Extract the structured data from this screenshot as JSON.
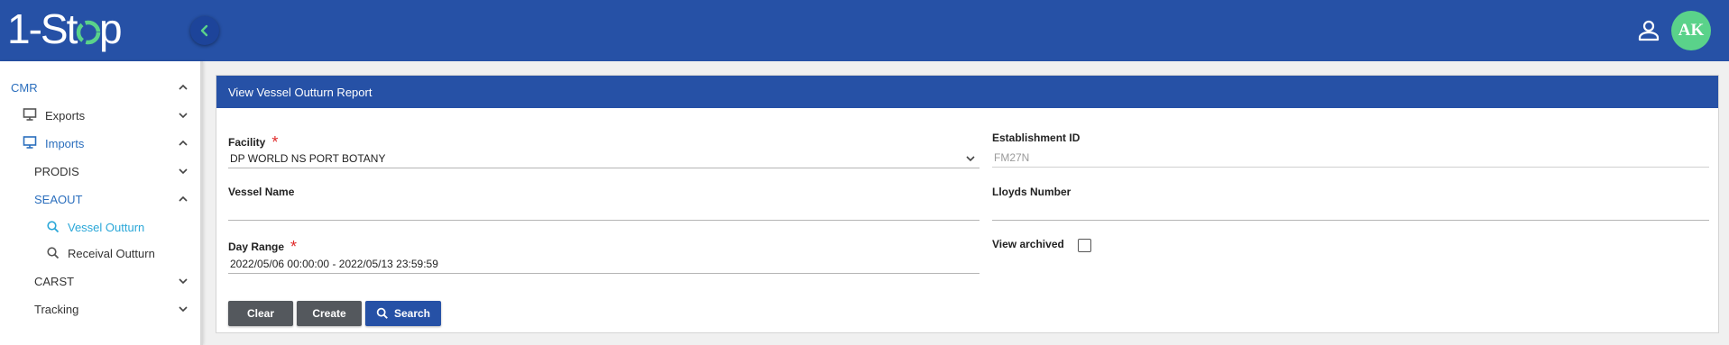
{
  "header": {
    "logo_text": "1-Stop",
    "avatar_initials": "AK",
    "brand_color": "#2651a6",
    "avatar_color": "#5ad28a"
  },
  "sidebar": {
    "items": [
      {
        "label": "CMR",
        "expanded": true
      },
      {
        "label": "Exports",
        "icon": "monitor-icon",
        "expanded": false
      },
      {
        "label": "Imports",
        "icon": "monitor-icon",
        "expanded": true
      },
      {
        "label": "PRODIS",
        "expanded": false
      },
      {
        "label": "SEAOUT",
        "expanded": true
      },
      {
        "label": "Vessel Outturn",
        "icon": "search-icon",
        "active": true
      },
      {
        "label": "Receival Outturn",
        "icon": "search-icon"
      },
      {
        "label": "CARST",
        "expanded": false
      },
      {
        "label": "Tracking",
        "expanded": false
      }
    ]
  },
  "form": {
    "title": "View Vessel Outturn Report",
    "facility_label": "Facility",
    "facility_value": "DP WORLD NS PORT BOTANY",
    "establishment_label": "Establishment ID",
    "establishment_value": "FM27N",
    "vessel_name_label": "Vessel Name",
    "vessel_name_value": "",
    "lloyds_label": "Lloyds Number",
    "lloyds_value": "",
    "day_range_label": "Day Range",
    "day_range_value": "2022/05/06 00:00:00 - 2022/05/13 23:59:59",
    "view_archived_label": "View archived",
    "view_archived_checked": false,
    "required_mark": "*"
  },
  "buttons": {
    "clear": "Clear",
    "create": "Create",
    "search": "Search"
  }
}
